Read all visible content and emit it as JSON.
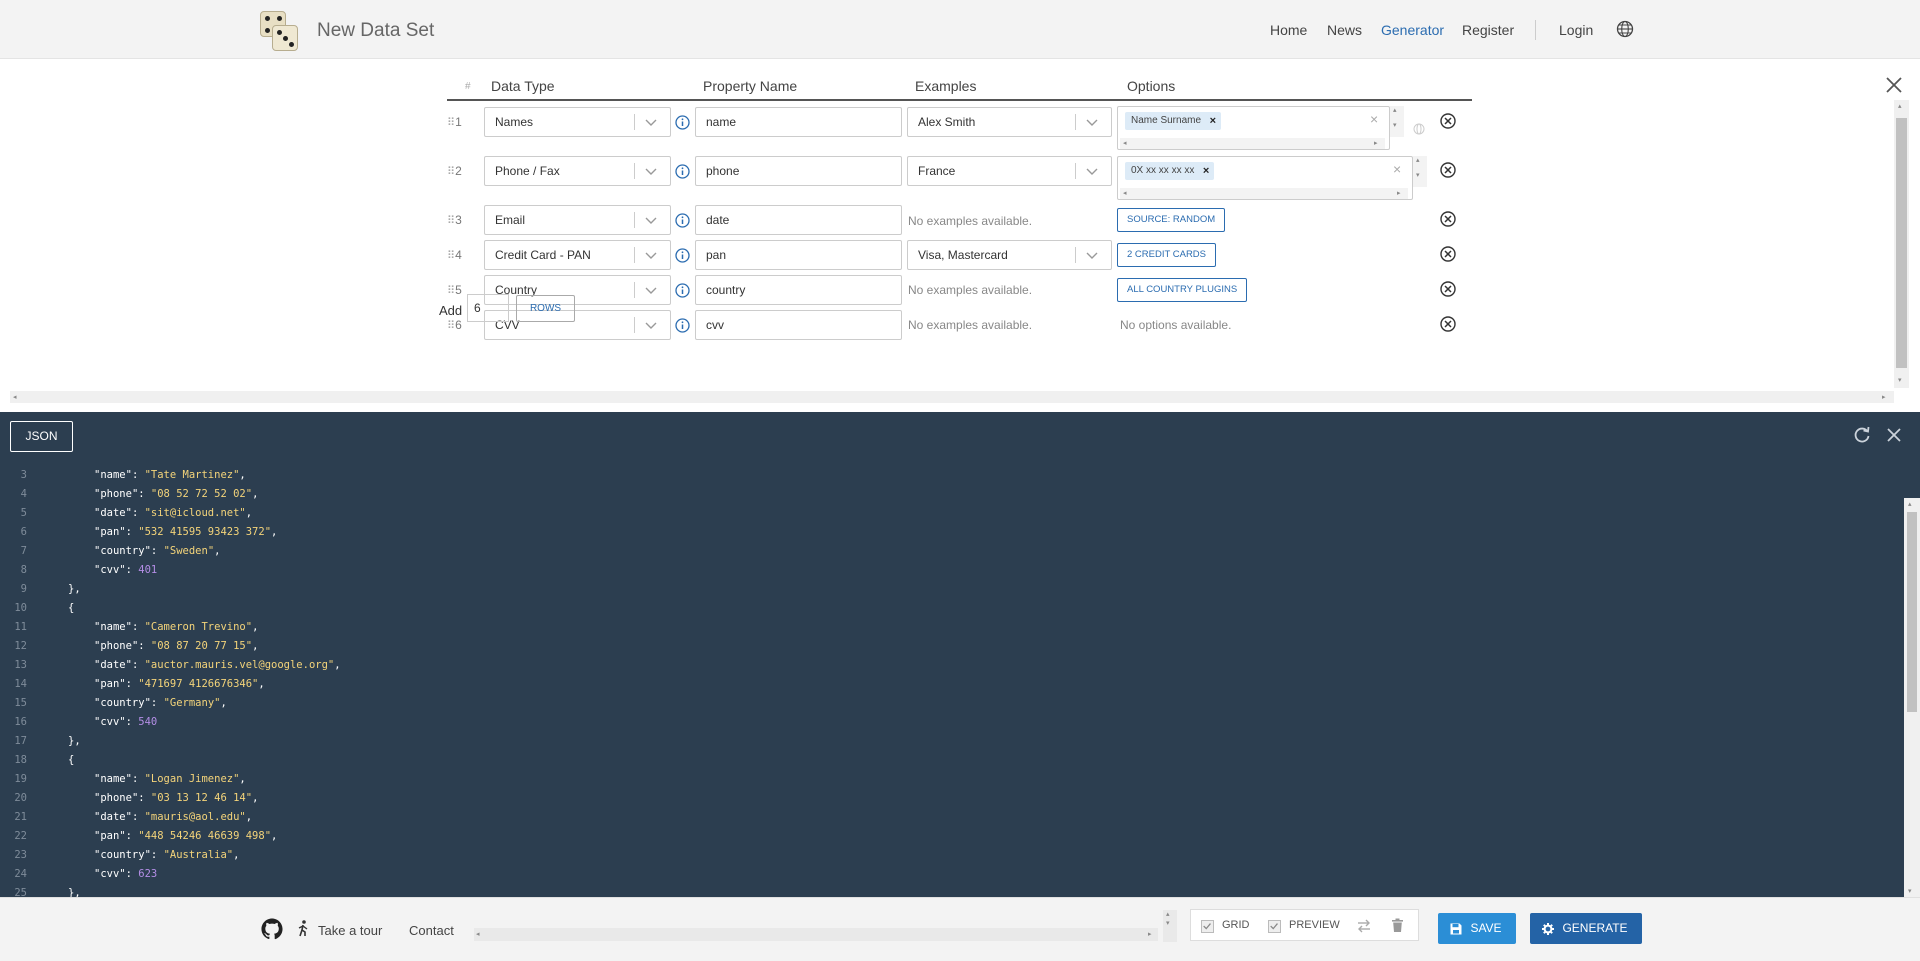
{
  "app": {
    "title": "New Data Set"
  },
  "nav": {
    "home": "Home",
    "news": "News",
    "generator": "Generator",
    "register": "Register",
    "login": "Login"
  },
  "grid": {
    "columns": {
      "order": "#",
      "data_type": "Data Type",
      "property_name": "Property Name",
      "examples": "Examples",
      "options": "Options"
    },
    "rows": [
      {
        "num": "1",
        "data_type": "Names",
        "property": "name",
        "example": "Alex Smith",
        "option_tag": "Name Surname"
      },
      {
        "num": "2",
        "data_type": "Phone / Fax",
        "property": "phone",
        "example": "France",
        "option_tag": "0X xx xx xx xx"
      },
      {
        "num": "3",
        "data_type": "Email",
        "property": "date",
        "example": "No examples available.",
        "option_button": "SOURCE: RANDOM"
      },
      {
        "num": "4",
        "data_type": "Credit Card - PAN",
        "property": "pan",
        "example": "Visa, Mastercard",
        "option_button": "2 CREDIT CARDS"
      },
      {
        "num": "5",
        "data_type": "Country",
        "property": "country",
        "example": "No examples available.",
        "option_button": "ALL COUNTRY PLUGINS"
      },
      {
        "num": "6",
        "data_type": "CVV",
        "property": "cvv",
        "example": "No examples available.",
        "option_text": "No options available."
      }
    ],
    "add": {
      "label": "Add",
      "count": "6",
      "rows_button": "ROWS"
    }
  },
  "json_panel": {
    "tab": "JSON",
    "lines": [
      {
        "n": "3",
        "key": "name",
        "val": "\"Tate Martinez\"",
        "type": "s",
        "comma": true,
        "indent": 2
      },
      {
        "n": "4",
        "key": "phone",
        "val": "\"08 52 72 52 02\"",
        "type": "s",
        "comma": true,
        "indent": 2
      },
      {
        "n": "5",
        "key": "date",
        "val": "\"sit@icloud.net\"",
        "type": "s",
        "comma": true,
        "indent": 2
      },
      {
        "n": "6",
        "key": "pan",
        "val": "\"532 41595 93423 372\"",
        "type": "s",
        "comma": true,
        "indent": 2
      },
      {
        "n": "7",
        "key": "country",
        "val": "\"Sweden\"",
        "type": "s",
        "comma": true,
        "indent": 2
      },
      {
        "n": "8",
        "key": "cvv",
        "val": "401",
        "type": "n",
        "comma": false,
        "indent": 2
      },
      {
        "n": "9",
        "raw": "},",
        "indent": 1
      },
      {
        "n": "10",
        "raw": "{",
        "indent": 1
      },
      {
        "n": "11",
        "key": "name",
        "val": "\"Cameron Trevino\"",
        "type": "s",
        "comma": true,
        "indent": 2
      },
      {
        "n": "12",
        "key": "phone",
        "val": "\"08 87 20 77 15\"",
        "type": "s",
        "comma": true,
        "indent": 2
      },
      {
        "n": "13",
        "key": "date",
        "val": "\"auctor.mauris.vel@google.org\"",
        "type": "s",
        "comma": true,
        "indent": 2
      },
      {
        "n": "14",
        "key": "pan",
        "val": "\"471697 4126676346\"",
        "type": "s",
        "comma": true,
        "indent": 2
      },
      {
        "n": "15",
        "key": "country",
        "val": "\"Germany\"",
        "type": "s",
        "comma": true,
        "indent": 2
      },
      {
        "n": "16",
        "key": "cvv",
        "val": "540",
        "type": "n",
        "comma": false,
        "indent": 2
      },
      {
        "n": "17",
        "raw": "},",
        "indent": 1
      },
      {
        "n": "18",
        "raw": "{",
        "indent": 1
      },
      {
        "n": "19",
        "key": "name",
        "val": "\"Logan Jimenez\"",
        "type": "s",
        "comma": true,
        "indent": 2
      },
      {
        "n": "20",
        "key": "phone",
        "val": "\"03 13 12 46 14\"",
        "type": "s",
        "comma": true,
        "indent": 2
      },
      {
        "n": "21",
        "key": "date",
        "val": "\"mauris@aol.edu\"",
        "type": "s",
        "comma": true,
        "indent": 2
      },
      {
        "n": "22",
        "key": "pan",
        "val": "\"448 54246 46639 498\"",
        "type": "s",
        "comma": true,
        "indent": 2
      },
      {
        "n": "23",
        "key": "country",
        "val": "\"Australia\"",
        "type": "s",
        "comma": true,
        "indent": 2
      },
      {
        "n": "24",
        "key": "cvv",
        "val": "623",
        "type": "n",
        "comma": false,
        "indent": 2
      },
      {
        "n": "25",
        "raw": "},",
        "indent": 1
      }
    ]
  },
  "footer": {
    "tour": "Take a tour",
    "contact": "Contact",
    "grid_label": "GRID",
    "preview_label": "PREVIEW",
    "save": "SAVE",
    "generate": "GENERATE"
  },
  "colors": {
    "accent": "#2b6cb0",
    "json_bg": "#2c3e50",
    "string": "#f4d47a",
    "number": "#b48ee6",
    "save": "#2b8ed6",
    "generate": "#2463a6"
  },
  "icons": [
    "github-icon",
    "walk-icon",
    "globe-icon",
    "info-icon",
    "close-icon",
    "refresh-icon",
    "trash-icon",
    "swap-icon",
    "save-icon",
    "gear-icon"
  ]
}
